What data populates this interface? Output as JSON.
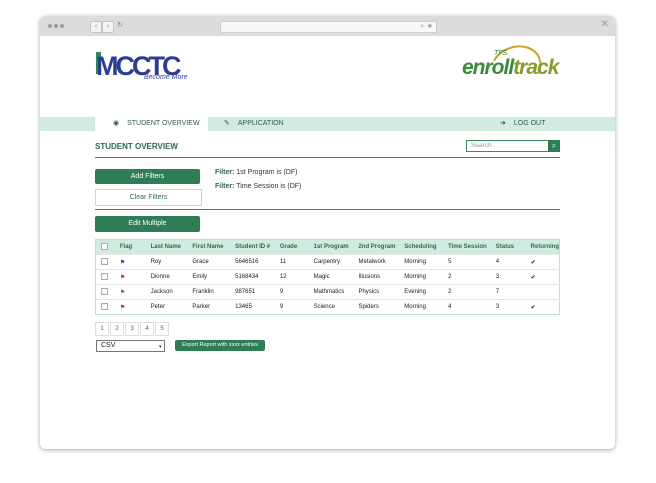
{
  "browser": {
    "url": ""
  },
  "logos": {
    "left": "MCCTC",
    "left_tagline": "Become More",
    "right_prefix": "TFS",
    "right_word_a": "enroll",
    "right_word_b": "track"
  },
  "nav": {
    "tabs": [
      {
        "label": "STUDENT OVERVIEW",
        "icon": "eye-icon"
      },
      {
        "label": "APPLICATION",
        "icon": "pencil-icon"
      }
    ],
    "logout_label": "LOG OUT",
    "logout_icon": "logout-icon"
  },
  "main": {
    "title": "STUDENT OVERVIEW",
    "search_placeholder": "Search",
    "add_filters_label": "Add Filters",
    "clear_filters_label": "Clear Filters",
    "filters": [
      {
        "key": "Filter:",
        "text": " 1st Program is (DF)"
      },
      {
        "key": "Filter:",
        "text": " Time Session is (DF)"
      }
    ],
    "edit_multiple_label": "Edit Multiple"
  },
  "table": {
    "headers": [
      "",
      "Flag",
      "Last Name",
      "First Name",
      "Student ID #",
      "Grade",
      "1st Program",
      "2nd Program",
      "Scheduling",
      "Time Session",
      "Status",
      "Returning"
    ],
    "rows": [
      {
        "flag": "blue",
        "cells": [
          "Roy",
          "Grace",
          "5646516",
          "11",
          "Carpentry",
          "Metalwork",
          "Morning",
          "5",
          "4",
          "✔"
        ]
      },
      {
        "flag": "red",
        "cells": [
          "Dionne",
          "Emily",
          "5168434",
          "12",
          "Magic",
          "Illusions",
          "Morning",
          "2",
          "3",
          "✔"
        ]
      },
      {
        "flag": "green",
        "cells": [
          "Jackson",
          "Franklin",
          "987651",
          "9",
          "Mathmatics",
          "Physics",
          "Evening",
          "2",
          "7",
          ""
        ]
      },
      {
        "flag": "red",
        "cells": [
          "Peter",
          "Parker",
          "13465",
          "9",
          "Science",
          "Spiders",
          "Morning",
          "4",
          "3",
          "✔"
        ]
      }
    ]
  },
  "pager": {
    "pages": [
      "1",
      "2",
      "3",
      "4",
      "5"
    ]
  },
  "export": {
    "format": "CSV",
    "button_label": "Export Report with xxxx entries"
  },
  "colors": {
    "accent": "#2e7d54",
    "nav_bg": "#d2ebe1",
    "flag_blue": "#1f3fbf",
    "flag_red": "#cc2222",
    "flag_green": "#2e8b3e"
  }
}
